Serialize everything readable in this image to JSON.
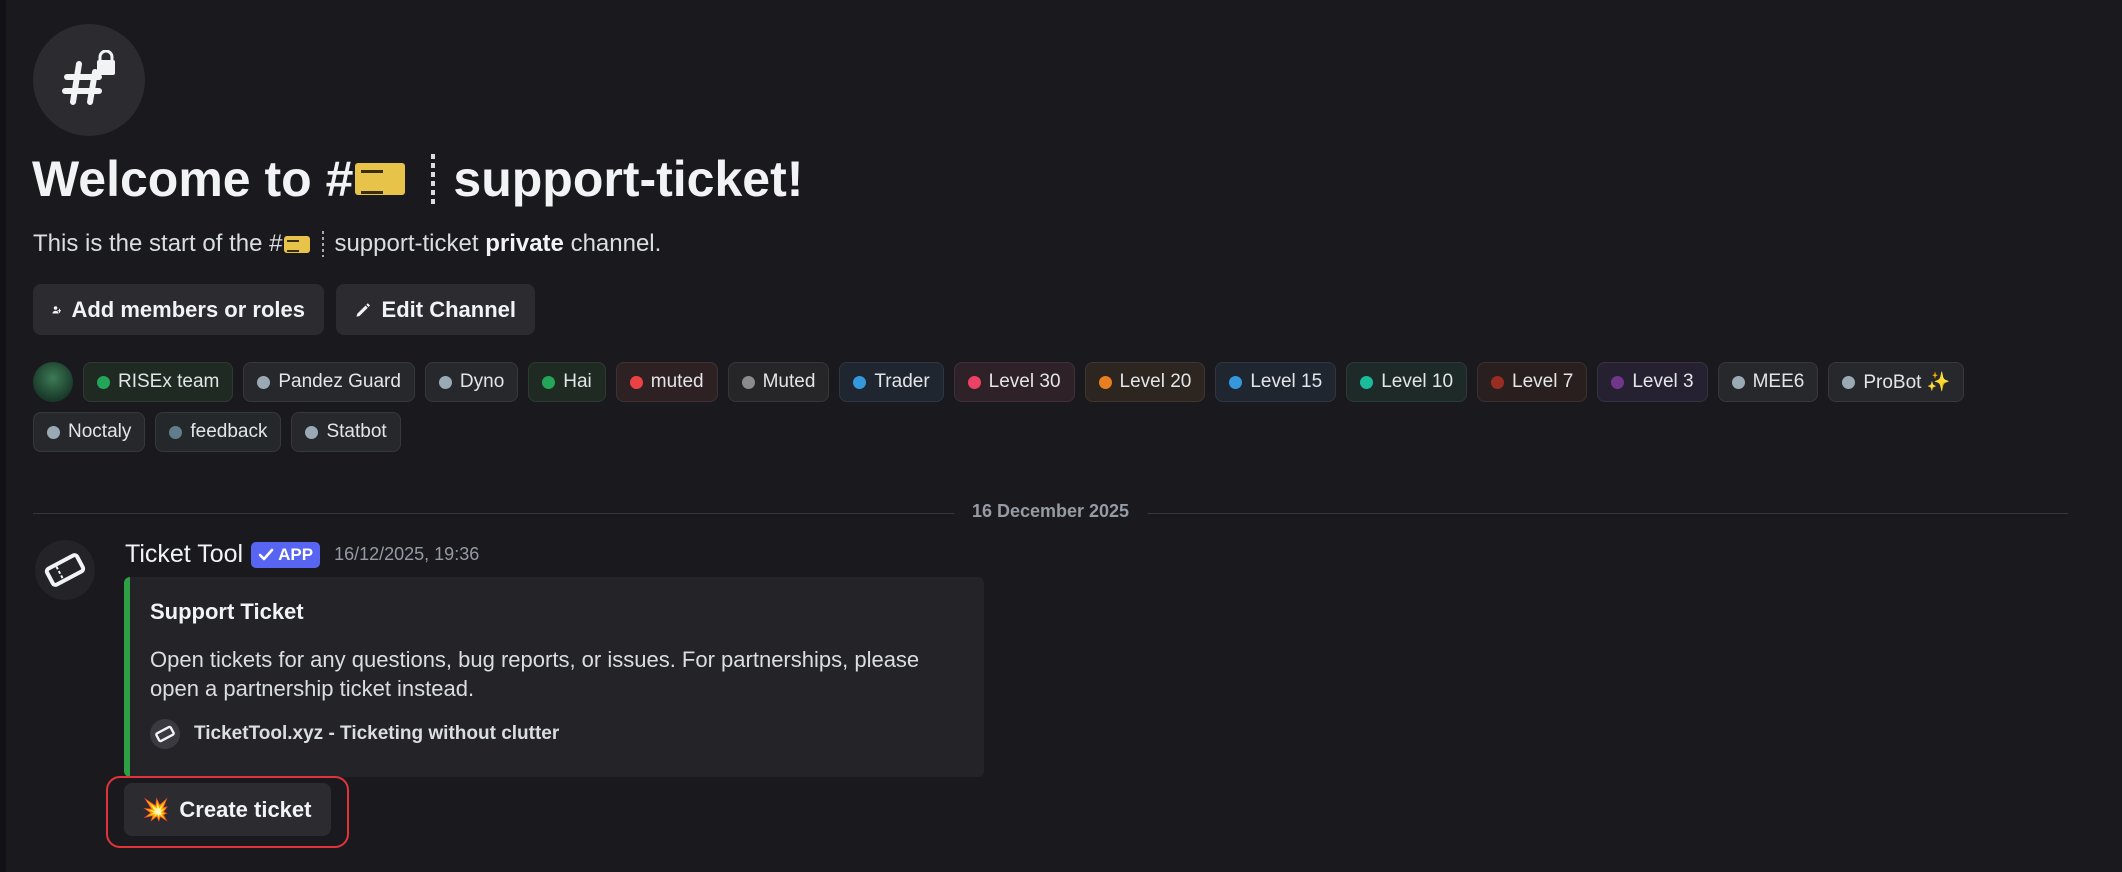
{
  "welcome": {
    "prefix": "Welcome to #",
    "channel_name": "support-ticket!",
    "subtitle_prefix": "This is the start of the #",
    "subtitle_channel": "support-ticket",
    "subtitle_private": "private",
    "subtitle_suffix": "channel."
  },
  "actions": {
    "add_members_label": "Add members or roles",
    "edit_channel_label": "Edit Channel"
  },
  "role_tags_row1": [
    {
      "label": "RISEx team",
      "color": "#23a55a",
      "bg": "#1e2a22"
    },
    {
      "label": "Pandez Guard",
      "color": "#99aab5",
      "bg": "#26282c"
    },
    {
      "label": "Dyno",
      "color": "#99aab5",
      "bg": "#26282c"
    },
    {
      "label": "Hai",
      "color": "#23a55a",
      "bg": "#1e2a22"
    },
    {
      "label": "muted",
      "color": "#ed4245",
      "bg": "#2e2124"
    },
    {
      "label": "Muted",
      "color": "#8a8a8f",
      "bg": "#262628"
    },
    {
      "label": "Trader",
      "color": "#3498db",
      "bg": "#1f2630"
    },
    {
      "label": "Level 30",
      "color": "#ed4265",
      "bg": "#2e2127"
    },
    {
      "label": "Level 20",
      "color": "#e67e22",
      "bg": "#2d2520"
    },
    {
      "label": "Level 15",
      "color": "#3498db",
      "bg": "#1f2630"
    },
    {
      "label": "Level 10",
      "color": "#1abc9c",
      "bg": "#1d2a28"
    },
    {
      "label": "Level 7",
      "color": "#992d22",
      "bg": "#2a1f1f"
    },
    {
      "label": "Level 3",
      "color": "#71368a",
      "bg": "#262130"
    },
    {
      "label": "MEE6",
      "color": "#99aab5",
      "bg": "#26282c"
    },
    {
      "label": "ProBot ✨",
      "color": "#99aab5",
      "bg": "#26282c"
    }
  ],
  "role_tags_row2": [
    {
      "label": "Noctaly",
      "color": "#99aab5",
      "bg": "#26282c"
    },
    {
      "label": "feedback",
      "color": "#607d8b",
      "bg": "#25282b"
    },
    {
      "label": "Statbot",
      "color": "#99aab5",
      "bg": "#26282c"
    }
  ],
  "date_divider": "16 December 2025",
  "message": {
    "author": "Ticket Tool",
    "badge": "APP",
    "timestamp": "16/12/2025, 19:36",
    "embed": {
      "title": "Support Ticket",
      "description": "Open tickets for any questions, bug reports, or issues. For partnerships, please open a partnership ticket instead.",
      "footer": "TicketTool.xyz - Ticketing without clutter",
      "accent_color": "#2ea043"
    },
    "button_label": "Create ticket",
    "button_emoji": "💥"
  }
}
